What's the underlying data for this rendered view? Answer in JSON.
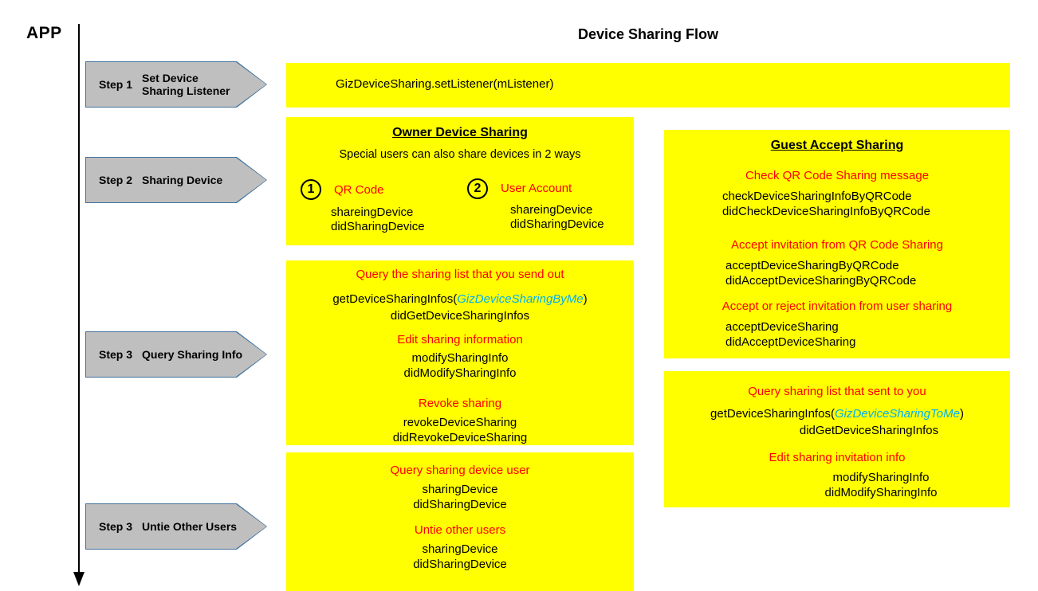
{
  "diagram": {
    "app_label": "APP",
    "title": "Device Sharing Flow"
  },
  "steps": [
    {
      "step": "Step 1",
      "title": "Set  Device\nSharing Listener"
    },
    {
      "step": "Step 2",
      "title": "Sharing Device"
    },
    {
      "step": "Step 3",
      "title": "Query Sharing Info"
    },
    {
      "step": "Step 3",
      "title": "Untie Other Users"
    }
  ],
  "panels": {
    "step1": {
      "code": "GizDeviceSharing.setListener(mListener)"
    },
    "owner": {
      "title": "Owner Device Sharing",
      "subtitle": "Special users can also share devices in 2 ways",
      "ways": [
        {
          "number": "1",
          "label": "QR Code",
          "methods": "shareingDevice\ndidSharingDevice"
        },
        {
          "number": "2",
          "label": "User Account",
          "methods": "shareingDevice\ndidSharingDevice"
        }
      ]
    },
    "query_sharing": {
      "sections": [
        {
          "heading": "Query the sharing list that you send out",
          "call_prefix": "getDeviceSharingInfos(",
          "call_param": "GizDeviceSharingByMe",
          "call_suffix": ")",
          "callback": "didGetDeviceSharingInfos"
        },
        {
          "heading": "Edit sharing information",
          "methods": "modifySharingInfo\ndidModifySharingInfo"
        },
        {
          "heading": "Revoke sharing",
          "methods": "revokeDeviceSharing\ndidRevokeDeviceSharing"
        }
      ]
    },
    "untie_users": {
      "sections": [
        {
          "heading": "Query sharing device user",
          "methods": "sharingDevice\ndidSharingDevice"
        },
        {
          "heading": "Untie other users",
          "methods": "sharingDevice\ndidSharingDevice"
        }
      ]
    },
    "guest_accept": {
      "title": "Guest Accept Sharing",
      "sections": [
        {
          "heading": "Check QR Code Sharing message",
          "methods": "checkDeviceSharingInfoByQRCode\ndidCheckDeviceSharingInfoByQRCode"
        },
        {
          "heading": "Accept invitation from QR Code Sharing",
          "methods": "acceptDeviceSharingByQRCode\ndidAcceptDeviceSharingByQRCode"
        },
        {
          "heading": "Accept or reject invitation from user sharing",
          "methods": "acceptDeviceSharing\ndidAcceptDeviceSharing"
        }
      ]
    },
    "guest_query": {
      "sections": [
        {
          "heading": "Query sharing list that sent to you",
          "call_prefix": "getDeviceSharingInfos(",
          "call_param": "GizDeviceSharingToMe",
          "call_suffix": ")",
          "callback": "didGetDeviceSharingInfos"
        },
        {
          "heading": "Edit sharing invitation info",
          "methods": "modifySharingInfo\ndidModifySharingInfo"
        }
      ]
    }
  },
  "colors": {
    "panel_bg": "#ffff00",
    "chevron_fill": "#bfbfbf",
    "chevron_border": "#41719c",
    "heading_red": "#ff0000",
    "param_cyan": "#00b0f0",
    "text_black": "#000000"
  }
}
